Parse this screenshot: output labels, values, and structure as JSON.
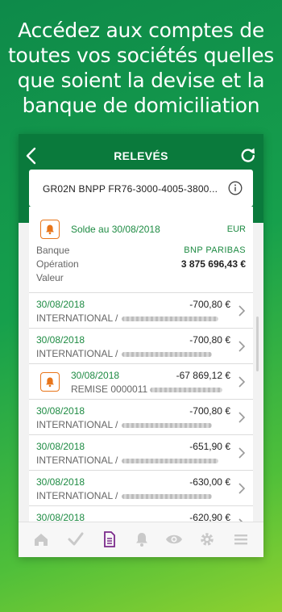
{
  "promo": {
    "line1": "Accédez aux comptes de",
    "line2": "toutes vos sociétés quelles",
    "line3": "que soient la devise et la",
    "line4": "banque de domiciliation"
  },
  "header": {
    "title": "RELEVÉS"
  },
  "account": {
    "label": "GR02N BNPP FR76-3000-4005-3800..."
  },
  "summary": {
    "solde": "Solde au 30/08/2018",
    "currency": "EUR",
    "banque_label": "Banque",
    "banque_value": "BNP PARIBAS",
    "operation_label": "Opération",
    "operation_value": "3 875 696,43 €",
    "valeur_label": "Valeur"
  },
  "transactions": [
    {
      "date": "30/08/2018",
      "amount": "-700,80 €",
      "label": "INTERNATIONAL /",
      "alert": false
    },
    {
      "date": "30/08/2018",
      "amount": "-700,80 €",
      "label": "INTERNATIONAL /",
      "alert": false
    },
    {
      "date": "30/08/2018",
      "amount": "-67 869,12 €",
      "label": "REMISE 0000011",
      "alert": true
    },
    {
      "date": "30/08/2018",
      "amount": "-700,80 €",
      "label": "INTERNATIONAL /",
      "alert": false
    },
    {
      "date": "30/08/2018",
      "amount": "-651,90 €",
      "label": "INTERNATIONAL /",
      "alert": false
    },
    {
      "date": "30/08/2018",
      "amount": "-630,00 €",
      "label": "INTERNATIONAL /",
      "alert": false
    },
    {
      "date": "30/08/2018",
      "amount": "-620,90 €",
      "label": "INTERNATIONAL /",
      "alert": false
    }
  ],
  "tabs": [
    "home-icon",
    "check-icon",
    "document-icon",
    "bell-icon",
    "eye-icon",
    "gear-icon",
    "menu-icon"
  ],
  "colors": {
    "primary_green": "#0a7a3c",
    "text_green": "#1e8b43",
    "alert_orange": "#e8751a",
    "active_tab": "#7b2a8b"
  }
}
